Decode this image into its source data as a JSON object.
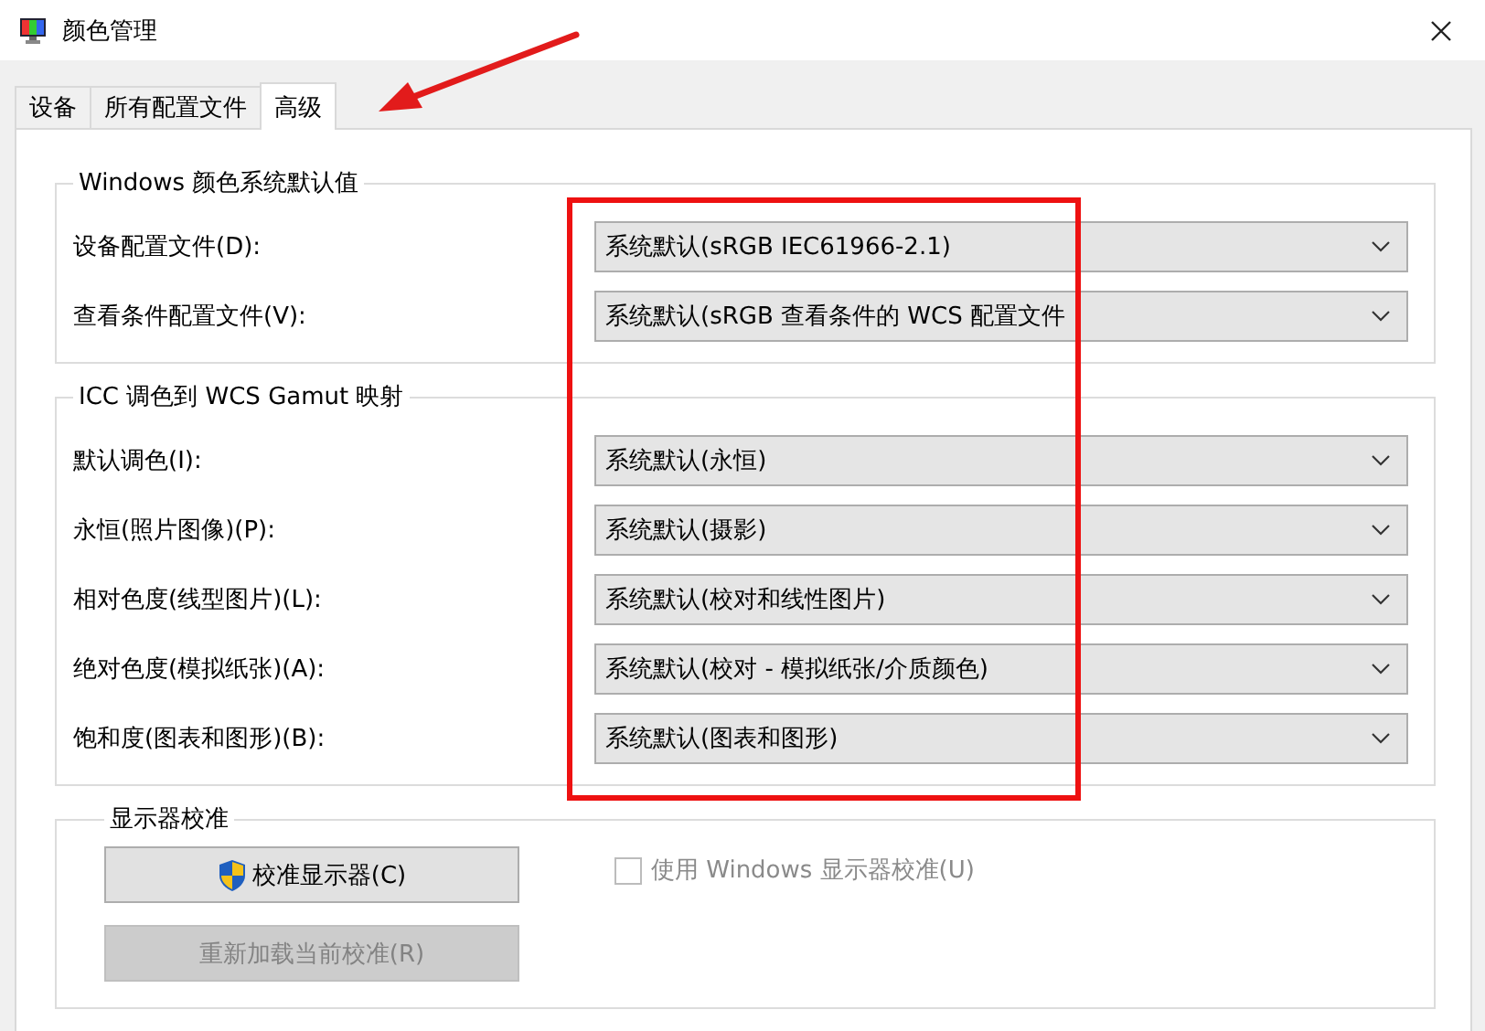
{
  "window": {
    "title": "颜色管理"
  },
  "tabs": [
    {
      "label": "设备",
      "selected": false
    },
    {
      "label": "所有配置文件",
      "selected": false
    },
    {
      "label": "高级",
      "selected": true
    }
  ],
  "groups": [
    {
      "title": "Windows 颜色系统默认值",
      "rows": [
        {
          "label": "设备配置文件(D):",
          "value": "系统默认(sRGB IEC61966-2.1)"
        },
        {
          "label": "查看条件配置文件(V):",
          "value": "系统默认(sRGB 查看条件的 WCS 配置文件"
        }
      ]
    },
    {
      "title": "ICC 调色到 WCS Gamut 映射",
      "rows": [
        {
          "label": "默认调色(I):",
          "value": "系统默认(永恒)"
        },
        {
          "label": "永恒(照片图像)(P):",
          "value": "系统默认(摄影)"
        },
        {
          "label": "相对色度(线型图片)(L):",
          "value": "系统默认(校对和线性图片)"
        },
        {
          "label": "绝对色度(模拟纸张)(A):",
          "value": "系统默认(校对 - 模拟纸张/介质颜色)"
        },
        {
          "label": "饱和度(图表和图形)(B):",
          "value": "系统默认(图表和图形)"
        }
      ]
    }
  ],
  "calibration": {
    "title": "显示器校准",
    "buttons": [
      {
        "label": "校准显示器(C)",
        "disabled": false,
        "shield": true
      },
      {
        "label": "重新加载当前校准(R)",
        "disabled": true,
        "shield": false
      }
    ],
    "checkbox": {
      "label": "使用 Windows 显示器校准(U)",
      "checked": false,
      "disabled": true
    }
  }
}
